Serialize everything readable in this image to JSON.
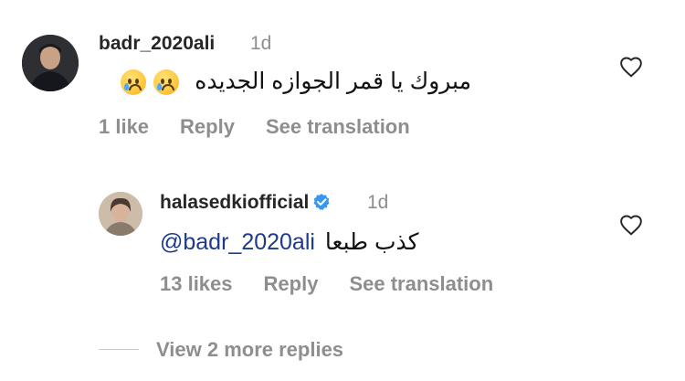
{
  "comments": [
    {
      "username": "badr_2020ali",
      "time": "1d",
      "text": "مبروك يا قمر الجوازه الجديده",
      "emoji": [
        "crying-face",
        "crying-face"
      ],
      "likes": "1 like",
      "reply_label": "Reply",
      "translate_label": "See translation"
    },
    {
      "username": "halasedkiofficial",
      "verified": true,
      "time": "1d",
      "text": "كذب طبعا",
      "mention": "@badr_2020ali",
      "likes": "13 likes",
      "reply_label": "Reply",
      "translate_label": "See translation"
    }
  ],
  "more_replies": "View 2 more replies",
  "icons": {
    "like": "heart-outline-icon",
    "verified": "verified-badge-icon",
    "emoji": "crying-face-emoji"
  },
  "colors": {
    "text": "#262626",
    "meta": "#8e8e8e",
    "mention": "#1e3a8a",
    "verified": "#3897f0"
  }
}
